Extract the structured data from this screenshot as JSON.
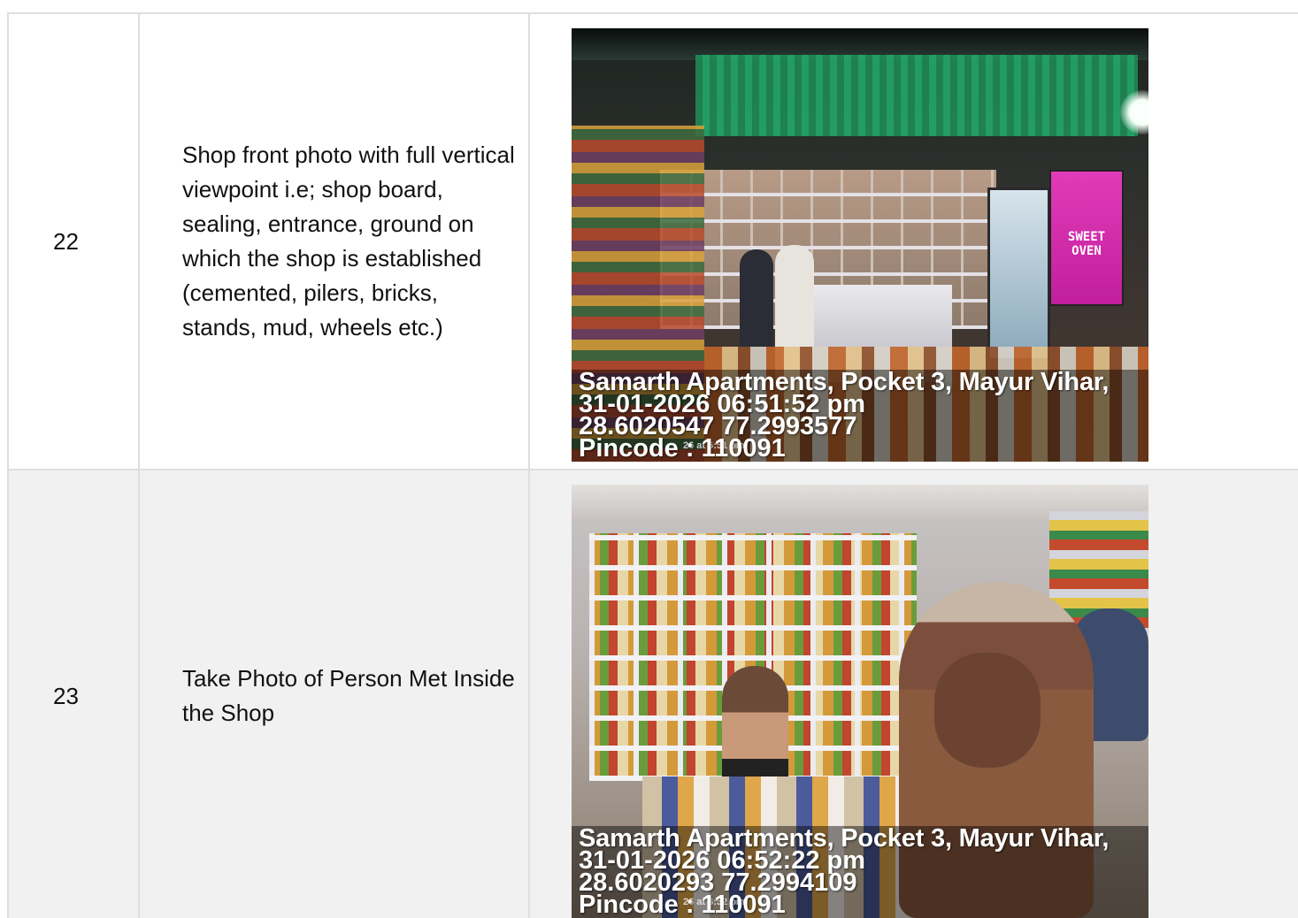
{
  "rows": [
    {
      "number": "22",
      "description": "Shop front photo with full vertical viewpoint i.e; shop board, sealing, entrance, ground on which the shop is established (cemented, pilers, bricks, stands, mud, wheels etc.)",
      "photo": {
        "subject": "shop front at night",
        "banner_text": "SWEET OVEN",
        "stamp": {
          "address": "Samarth Apartments, Pocket 3, Mayur Vihar,",
          "datetime": "31-01-2026 06:51:52 pm",
          "coords": "28.6020547 77.2993577",
          "pincode": "Pincode : 110091",
          "small": "26 at 6:51 pm"
        }
      }
    },
    {
      "number": "23",
      "description": "Take Photo of Person Met Inside the Shop",
      "photo": {
        "subject": "person inside shop",
        "stamp": {
          "address": "Samarth Apartments, Pocket 3, Mayur Vihar,",
          "datetime": "31-01-2026 06:52:22 pm",
          "coords": "28.6020293 77.2994109",
          "pincode": "Pincode : 110091",
          "small": "26 at 6:52 pm"
        }
      }
    }
  ],
  "colors": {
    "border": "#dedede",
    "row_alt_bg": "#f1f1f1",
    "text": "#111111"
  }
}
